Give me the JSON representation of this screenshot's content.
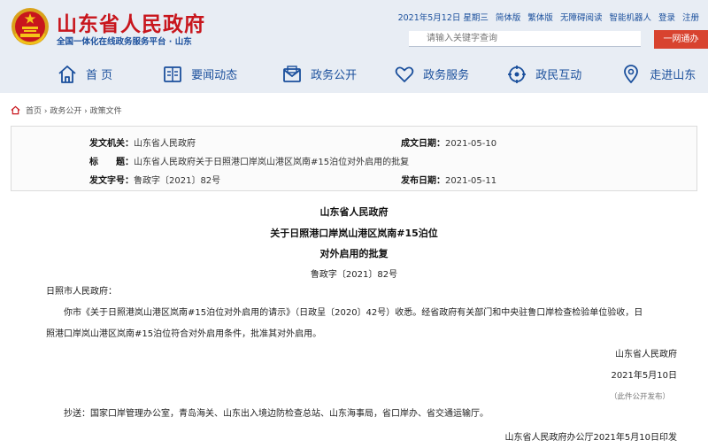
{
  "header": {
    "site_name": "山东省人民政府",
    "site_sub": "全国一体化在线政务服务平台 · 山东",
    "top_links": [
      "2021年5月12日 星期三",
      "简体版",
      "繁体版",
      "无障碍阅读",
      "智能机器人",
      "登录",
      "注册"
    ],
    "search_placeholder": "请输入关键字查询",
    "search_button": "一网通办",
    "nav": [
      {
        "label": "首 页",
        "icon": "home-icon"
      },
      {
        "label": "要闻动态",
        "icon": "news-icon"
      },
      {
        "label": "政务公开",
        "icon": "envelope-icon"
      },
      {
        "label": "政务服务",
        "icon": "heart-icon"
      },
      {
        "label": "政民互动",
        "icon": "interaction-icon"
      },
      {
        "label": "走进山东",
        "icon": "location-icon"
      }
    ]
  },
  "breadcrumb": "首页 › 政务公开 › 政策文件",
  "info": {
    "issuer_label": "发文机关：",
    "issuer": "山东省人民政府",
    "date_label": "成文日期：",
    "date": "2021-05-10",
    "title_label": "标　　题：",
    "title": "山东省人民政府关于日照港口岸岚山港区岚南#15泊位对外启用的批复",
    "docno_label": "发文字号：",
    "docno": "鲁政字〔2021〕82号",
    "pubdate_label": "发布日期：",
    "pubdate": "2021-05-11"
  },
  "doc": {
    "head1": "山东省人民政府",
    "head2": "关于日照港口岸岚山港区岚南#15泊位",
    "head3": "对外启用的批复",
    "number": "鲁政字〔2021〕82号",
    "addressee": "日照市人民政府：",
    "body_line1": "你市《关于日照港岚山港区岚南#15泊位对外启用的请示》（日政呈〔2020〕42号）收悉。经省政府有关部门和中央驻鲁口岸检查检验单位验收，日",
    "body_line2": "照港口岸岚山港区岚南#15泊位符合对外启用条件，批准其对外启用。",
    "signer": "山东省人民政府",
    "sign_date": "2021年5月10日",
    "stamp_text": "（此件公开发布）",
    "cc": "抄送：国家口岸管理办公室，青岛海关、山东出入境边防检查总站、山东海事局，省口岸办、省交通运输厅。",
    "footer": "山东省人民政府办公厅2021年5月10日印发"
  },
  "colors": {
    "brand_red": "#c8161d",
    "brand_blue": "#1a4f9c",
    "header_bg": "#e8edf4",
    "button_red": "#d8432f"
  }
}
